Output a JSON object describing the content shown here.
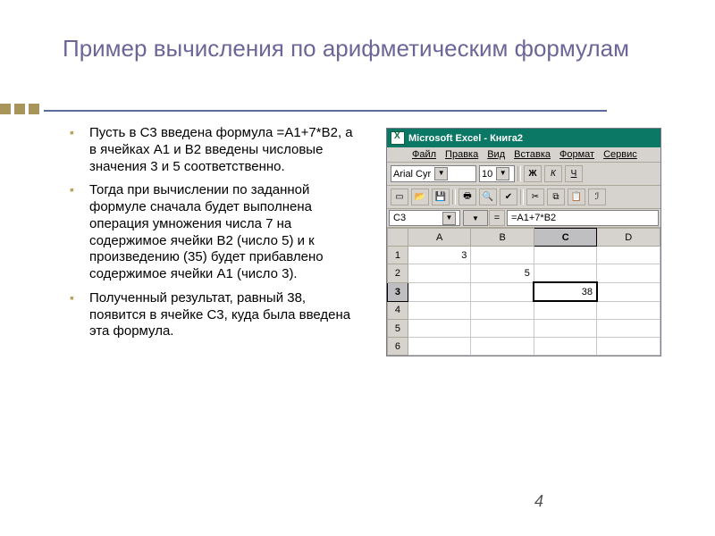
{
  "title": "Пример вычисления по арифметическим формулам",
  "bullets": [
    "Пусть в С3 введена формула =А1+7*В2, а в ячейках А1 и В2 введены числовые значения 3 и 5 соответственно.",
    "Тогда при вычислении по заданной формуле сначала будет выполнена операция умножения числа 7 на содержимое ячейки В2 (число 5) и к произведению (35) будет прибавлено содержимое ячейки А1 (число 3).",
    "Полученный результат, равный 38, появится в ячейке С3, куда была введена эта формула."
  ],
  "excel": {
    "titlebar": "Microsoft Excel - Книга2",
    "menu": {
      "file": "Файл",
      "edit": "Правка",
      "view": "Вид",
      "insert": "Вставка",
      "format": "Формат",
      "service": "Сервис"
    },
    "font": {
      "name": "Arial Cyr",
      "size": "10",
      "sep": "",
      "bold": "Ж",
      "italic": "К",
      "underline": "Ч"
    },
    "namebox": "C3",
    "equals": "=",
    "formula": "=A1+7*B2",
    "columns": [
      "A",
      "B",
      "C",
      "D"
    ],
    "rows": [
      "1",
      "2",
      "3",
      "4",
      "5",
      "6"
    ],
    "cells": {
      "A1": "3",
      "B2": "5",
      "C3": "38"
    }
  },
  "pagenum": "4"
}
